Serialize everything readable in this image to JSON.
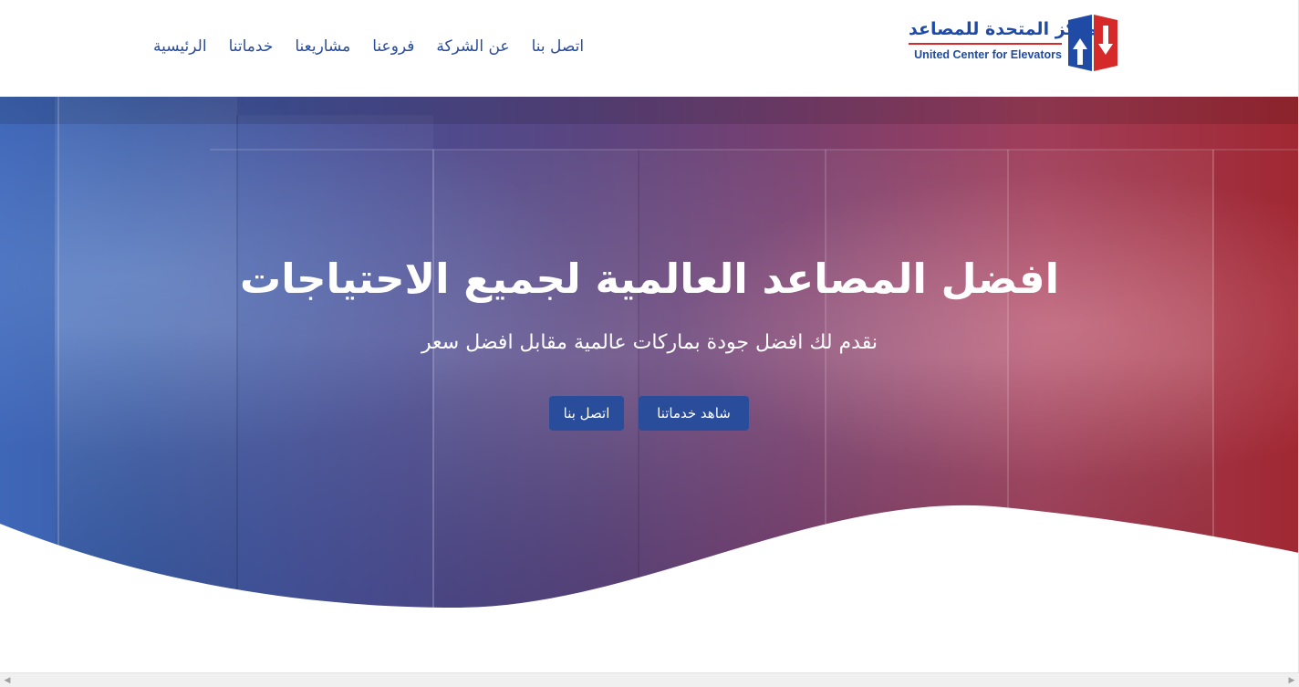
{
  "brand": {
    "name_ar": "مركز المتحدة للمصاعد",
    "name_en": "United Center for Elevators",
    "colors": {
      "blue": "#1f4aa6",
      "red": "#d62a2a"
    }
  },
  "nav": {
    "items": [
      {
        "label": "الرئيسية"
      },
      {
        "label": "خدماتنا"
      },
      {
        "label": "مشاريعنا"
      },
      {
        "label": "فروعنا"
      },
      {
        "label": "عن الشركة"
      },
      {
        "label": "اتصل بنا"
      }
    ]
  },
  "hero": {
    "title": "افضل المصاعد العالمية لجميع الاحتياجات",
    "subtitle": "نقدم لك افضل جودة بماركات عالمية مقابل افضل سعر",
    "buttons": {
      "services": "شاهد خدماتنا",
      "contact": "اتصل بنا"
    }
  },
  "icons": {
    "logo": "elevator-arrows-logo-icon",
    "scroll_left": "scroll-left-arrow-icon",
    "scroll_right": "scroll-right-arrow-icon"
  }
}
